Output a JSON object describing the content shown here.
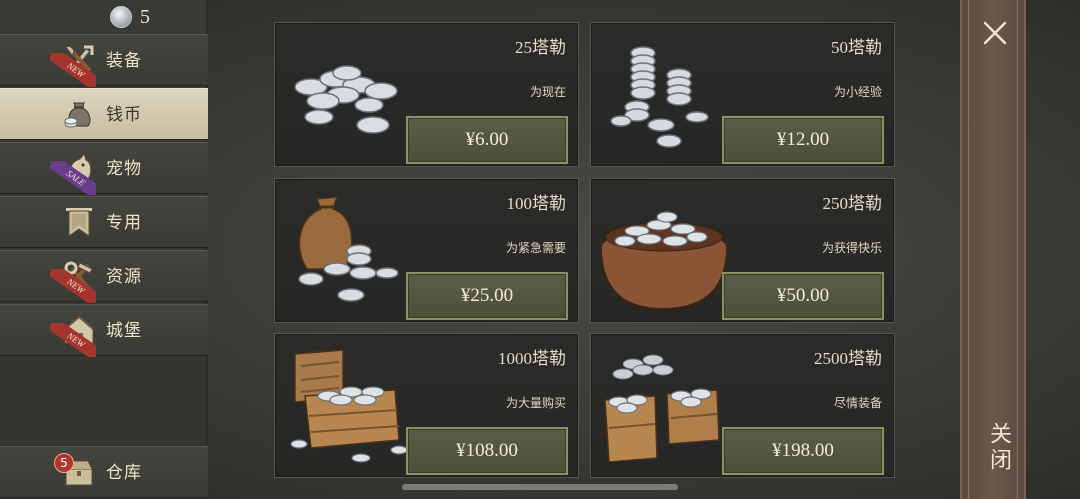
{
  "currency": {
    "icon": "silver-coin-icon",
    "amount": "5"
  },
  "sidebar": {
    "items": [
      {
        "id": "equipment",
        "label": "装备",
        "icon": "sword-axe-icon",
        "tag": "NEW",
        "active": false
      },
      {
        "id": "coins",
        "label": "钱币",
        "icon": "coin-bag-icon",
        "tag": "",
        "active": true
      },
      {
        "id": "pets",
        "label": "宠物",
        "icon": "paw-icon",
        "tag": "SALE",
        "active": false
      },
      {
        "id": "exclusive",
        "label": "专用",
        "icon": "banner-icon",
        "tag": "",
        "active": false
      },
      {
        "id": "resources",
        "label": "资源",
        "icon": "tools-icon",
        "tag": "NEW",
        "active": false
      },
      {
        "id": "castle",
        "label": "城堡",
        "icon": "castle-icon",
        "tag": "NEW",
        "active": false
      }
    ],
    "warehouse": {
      "label": "仓库",
      "icon": "chest-icon",
      "badge": "5"
    }
  },
  "products": [
    {
      "amount": "25塔勒",
      "desc": "为现在",
      "price": "¥6.00",
      "art": "coin-pile-small"
    },
    {
      "amount": "50塔勒",
      "desc": "为小经验",
      "price": "¥12.00",
      "art": "coin-stacks"
    },
    {
      "amount": "100塔勒",
      "desc": "为紧急需要",
      "price": "¥25.00",
      "art": "coin-sack"
    },
    {
      "amount": "250塔勒",
      "desc": "为获得快乐",
      "price": "¥50.00",
      "art": "coin-cauldron"
    },
    {
      "amount": "1000塔勒",
      "desc": "为大量购买",
      "price": "¥108.00",
      "art": "coin-chest"
    },
    {
      "amount": "2500塔勒",
      "desc": "尽情装备",
      "price": "¥198.00",
      "art": "coin-crates"
    }
  ],
  "close": {
    "label": "关闭",
    "icon": "close-icon"
  },
  "colors": {
    "accent_button": "#5b5e46",
    "button_border": "#8a9164",
    "active_tab": "#dcd4bd",
    "close_panel": "#6c574b"
  }
}
